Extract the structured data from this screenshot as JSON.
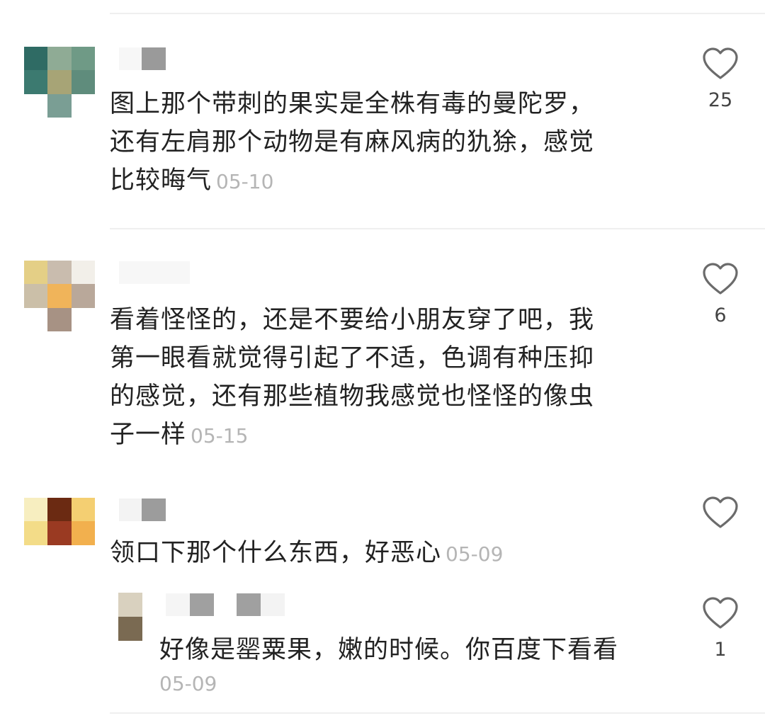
{
  "comments": [
    {
      "text": "图上那个带刺的果实是全株有毒的曼陀罗，\n还有左肩那个动物是有麻风病的犰狳，感觉\n比较晦气",
      "date": "05-10",
      "likes": "25"
    },
    {
      "text": "看着怪怪的，还是不要给小朋友穿了吧，我\n第一眼看就觉得引起了不适，色调有种压抑\n的感觉，还有那些植物我感觉也怪怪的像虫\n子一样",
      "date": "05-15",
      "likes": "6"
    },
    {
      "text": "领口下那个什么东西，好恶心",
      "date": "05-09",
      "likes": "",
      "reply": {
        "text": "好像是罂粟果，嫩的时候。你百度下看看",
        "date": "05-09",
        "likes": "1"
      }
    }
  ],
  "icons": {
    "like": "heart-outline-icon"
  },
  "colors": {
    "text": "#222222",
    "date": "#b5b5b5",
    "heart": "#6b6b6b",
    "divider": "#efefef"
  }
}
